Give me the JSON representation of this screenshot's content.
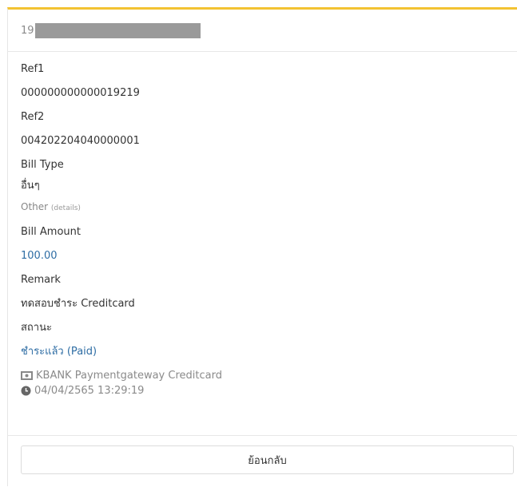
{
  "header": {
    "reference_prefix": "19"
  },
  "fields": {
    "ref1_label": "Ref1",
    "ref1_value": "000000000000019219",
    "ref2_label": "Ref2",
    "ref2_value": "004202204040000001",
    "bill_type_label": "Bill Type",
    "bill_type_value": "อื่นๆ",
    "bill_type_other": "Other",
    "bill_type_details": "(details)",
    "bill_amount_label": "Bill Amount",
    "bill_amount_value": "100.00",
    "remark_label": "Remark",
    "remark_value": "ทดสอบชำระ Creditcard",
    "status_label": "สถานะ",
    "status_value": "ชำระแล้ว (Paid)"
  },
  "payment": {
    "method": "KBANK Paymentgateway Creditcard",
    "method_icon": "money-icon",
    "timestamp": "04/04/2565 13:29:19",
    "timestamp_icon": "clock-icon"
  },
  "footer": {
    "back_label": "ย้อนกลับ"
  },
  "colors": {
    "accent_border": "#f3c332",
    "link_blue": "#2e6da4"
  }
}
